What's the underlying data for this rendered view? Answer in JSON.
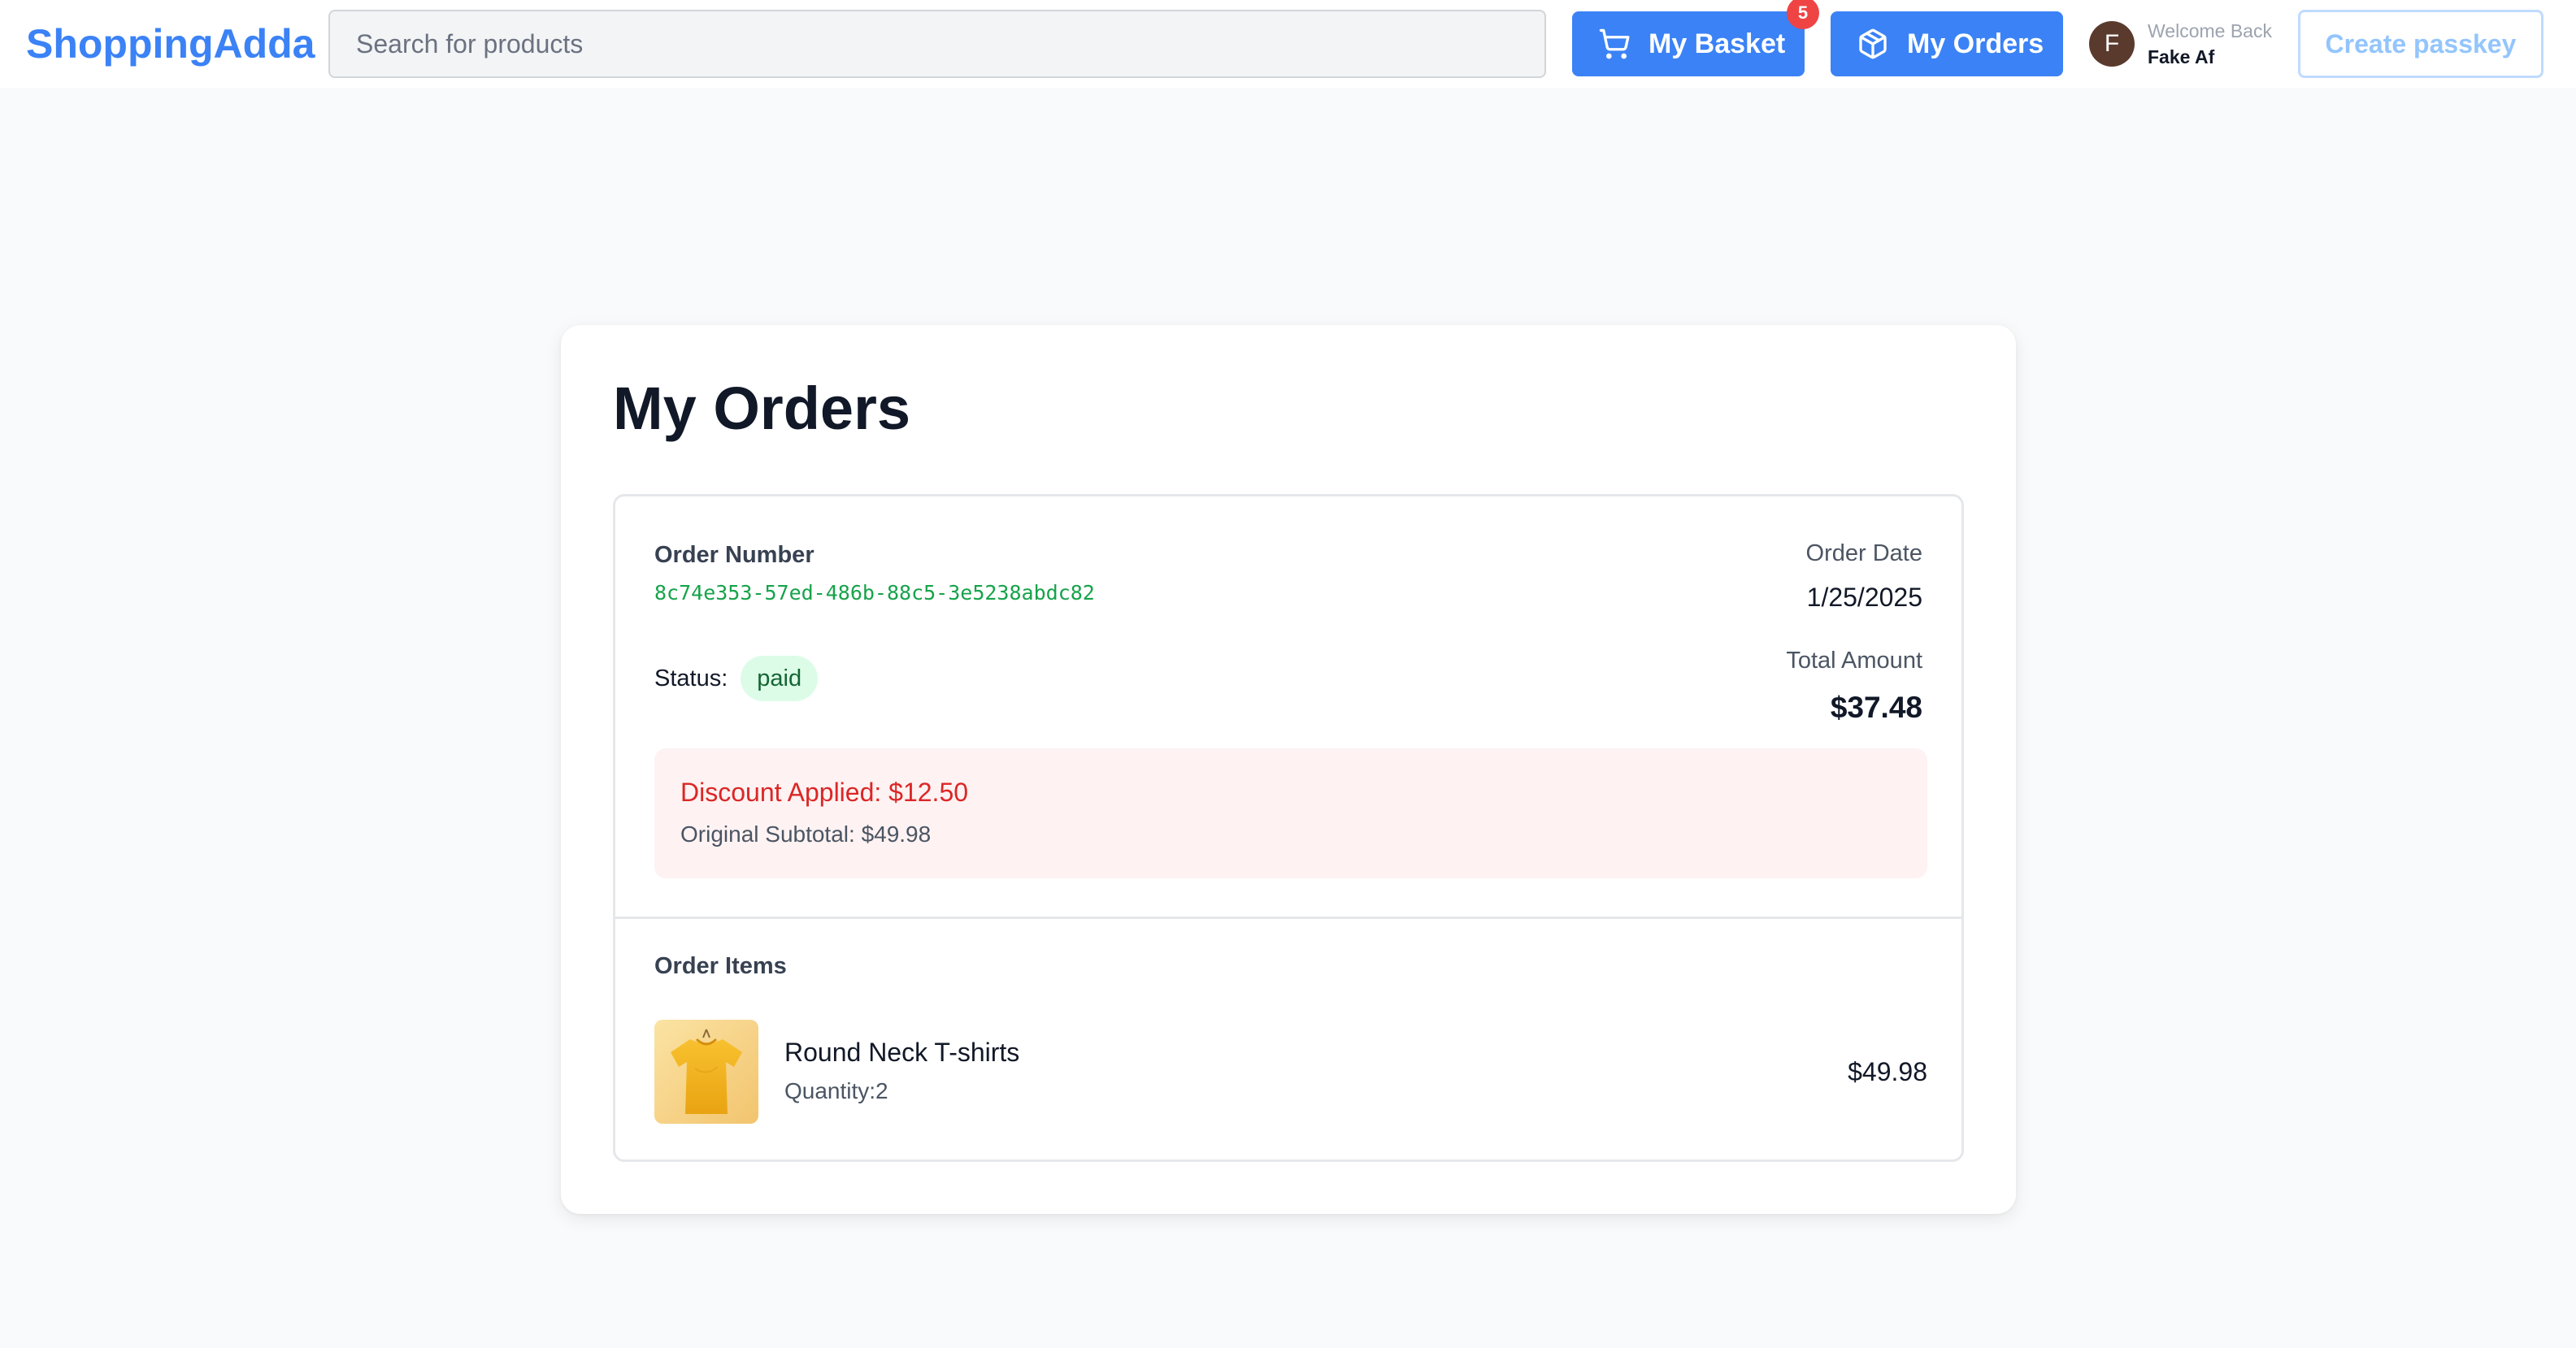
{
  "header": {
    "logo": "ShoppingAdda",
    "search_placeholder": "Search for products",
    "basket": {
      "label": "My Basket",
      "count": "5",
      "icon": "cart-icon"
    },
    "orders": {
      "label": "My Orders",
      "icon": "package-icon"
    },
    "user": {
      "initial": "F",
      "welcome": "Welcome Back",
      "name": "Fake Af"
    },
    "passkey_label": "Create passkey"
  },
  "main": {
    "title": "My Orders",
    "order": {
      "number_label": "Order Number",
      "number": "8c74e353-57ed-486b-88c5-3e5238abdc82",
      "status_label": "Status:",
      "status": "paid",
      "date_label": "Order Date",
      "date": "1/25/2025",
      "total_label": "Total Amount",
      "total": "$37.48",
      "discount": {
        "title": "Discount Applied: $12.50",
        "subtotal": "Original Subtotal: $49.98"
      },
      "items_label": "Order Items",
      "items": [
        {
          "name": "Round Neck T-shirts",
          "quantity": "Quantity:2",
          "price": "$49.98",
          "image": "yellow-tshirt"
        }
      ]
    }
  },
  "colors": {
    "brand": "#3b82f6",
    "status_paid_bg": "#dcfce7",
    "discount_text": "#dc2626",
    "order_id": "#16a34a",
    "badge": "#ef4444"
  }
}
